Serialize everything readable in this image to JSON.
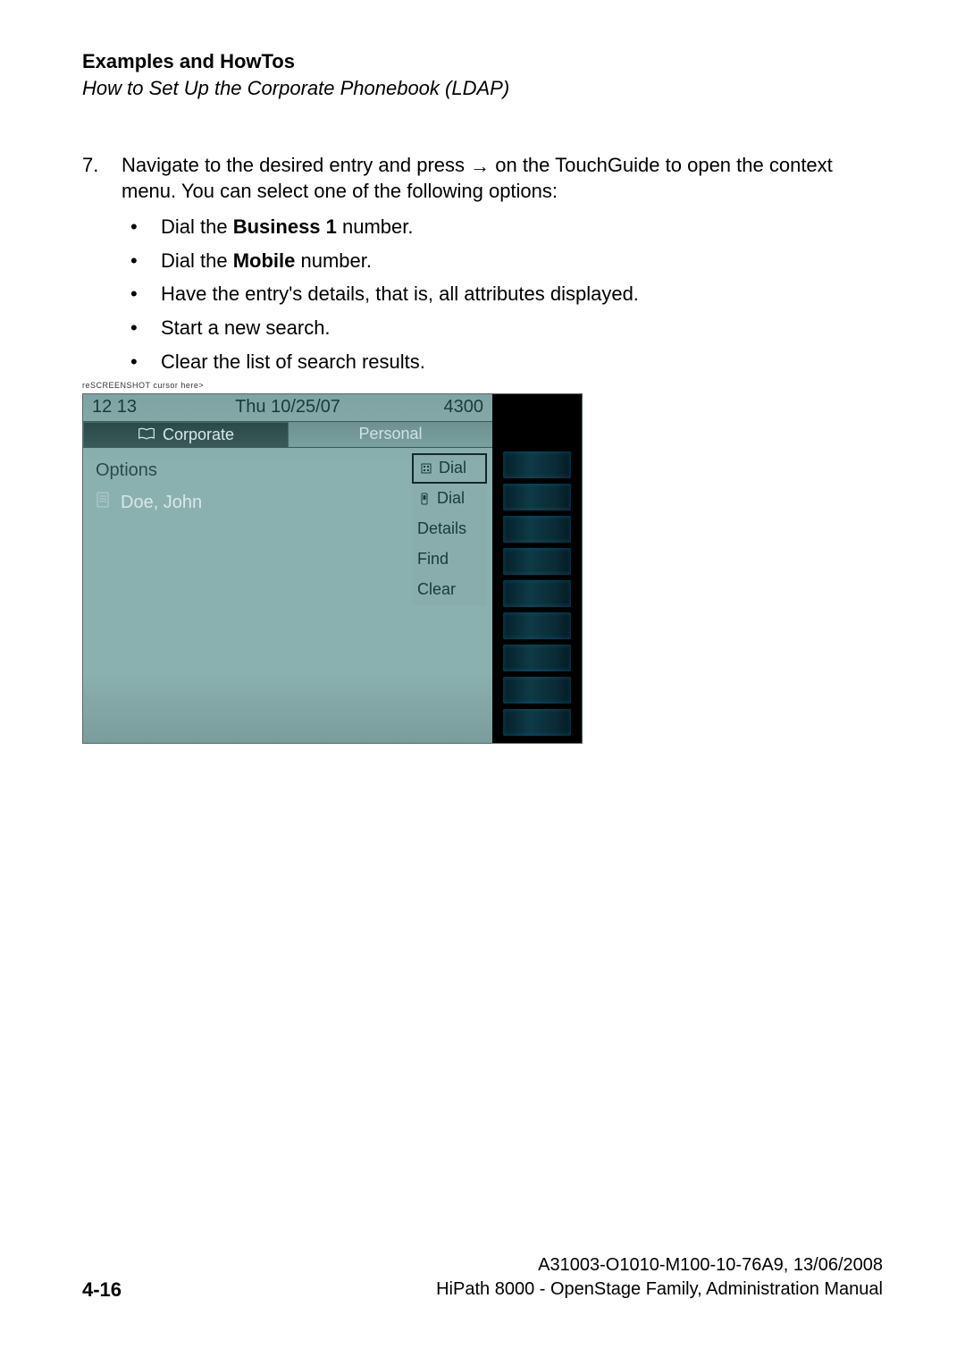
{
  "header": {
    "title": "Examples and HowTos",
    "subtitle": "How to Set Up the Corporate Phonebook (LDAP)"
  },
  "step": {
    "number": "7.",
    "text_before": "Navigate to the desired entry and press ",
    "text_after": " on the TouchGuide to open the context menu. You can select one of the following options:"
  },
  "bullets": {
    "b1_pre": "Dial the ",
    "b1_bold": "Business 1",
    "b1_post": " number.",
    "b2_pre": "Dial the ",
    "b2_bold": "Mobile",
    "b2_post": " number.",
    "b3": "Have the entry's details, that is, all attributes displayed.",
    "b4": "Start a new search.",
    "b5": "Clear the list of search results."
  },
  "phone": {
    "caption": "reSCREENSHOT cursor here>",
    "time": "12 13",
    "date": "Thu 10/25/07",
    "ext": "4300",
    "tabs": {
      "corporate": "Corporate",
      "personal": "Personal"
    },
    "options": "Options",
    "entry": "Doe, John",
    "ctx": {
      "dial1": "Dial",
      "dial2": "Dial",
      "details": "Details",
      "find": "Find",
      "clear": "Clear"
    }
  },
  "footer": {
    "page": "4-16",
    "doc_id": "A31003-O1010-M100-10-76A9, 13/06/2008",
    "doc_title": "HiPath 8000 - OpenStage Family, Administration Manual"
  }
}
